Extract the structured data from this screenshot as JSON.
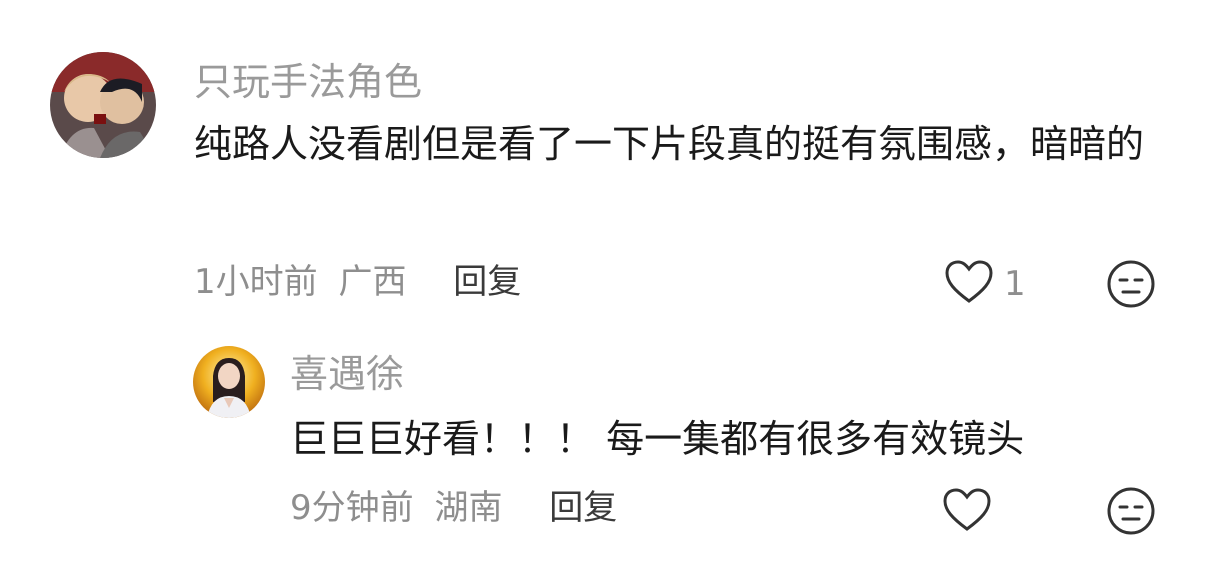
{
  "comments": [
    {
      "username": "只玩手法角色",
      "text": "纯路人没看剧但是看了一下片段真的挺有氛围感，暗暗的",
      "time": "1小时前",
      "location": "广西",
      "reply_label": "回复",
      "like_count": "1",
      "avatar_icon": "avatar-illustration",
      "like_icon": "heart-outline-icon",
      "react_icon": "meh-face-icon"
    },
    {
      "username": "喜遇徐",
      "text": "巨巨巨好看！！！ 每一集都有很多有效镜头",
      "time": "9分钟前",
      "location": "湖南",
      "reply_label": "回复",
      "like_count": "",
      "avatar_icon": "avatar-photo",
      "like_icon": "heart-outline-icon",
      "react_icon": "meh-face-icon"
    }
  ]
}
